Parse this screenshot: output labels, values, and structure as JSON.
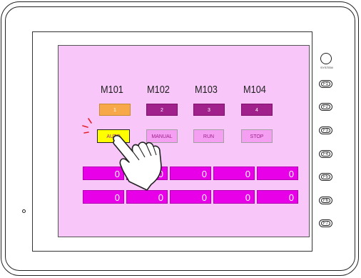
{
  "device": {
    "system_label": "SYSTEM",
    "function_keys": [
      "F1",
      "F2",
      "F3",
      "F4",
      "F5",
      "F6",
      "F7"
    ]
  },
  "screen": {
    "labels": [
      "M101",
      "M102",
      "M103",
      "M104"
    ],
    "lamps": [
      {
        "text": "1",
        "color": "#f7a94a"
      },
      {
        "text": "2",
        "color": "#a0208c"
      },
      {
        "text": "3",
        "color": "#a0208c"
      },
      {
        "text": "4",
        "color": "#a0208c"
      }
    ],
    "mode_buttons": [
      {
        "text": "AUTO",
        "active": true
      },
      {
        "text": "MANUAL",
        "active": false
      },
      {
        "text": "RUN",
        "active": false
      },
      {
        "text": "STOP",
        "active": false
      }
    ],
    "numeric_rows": [
      [
        "0",
        "0",
        "0",
        "0",
        "0"
      ],
      [
        "0",
        "0",
        "0",
        "0",
        "0"
      ]
    ]
  },
  "colors": {
    "screen_bg": "#f9c6f9",
    "numeric_bg": "#e800e8",
    "active_button": "#ffff00",
    "lamp_on": "#f7a94a",
    "lamp_off": "#a0208c"
  },
  "icons": {
    "hand": "pointing-hand-icon"
  }
}
